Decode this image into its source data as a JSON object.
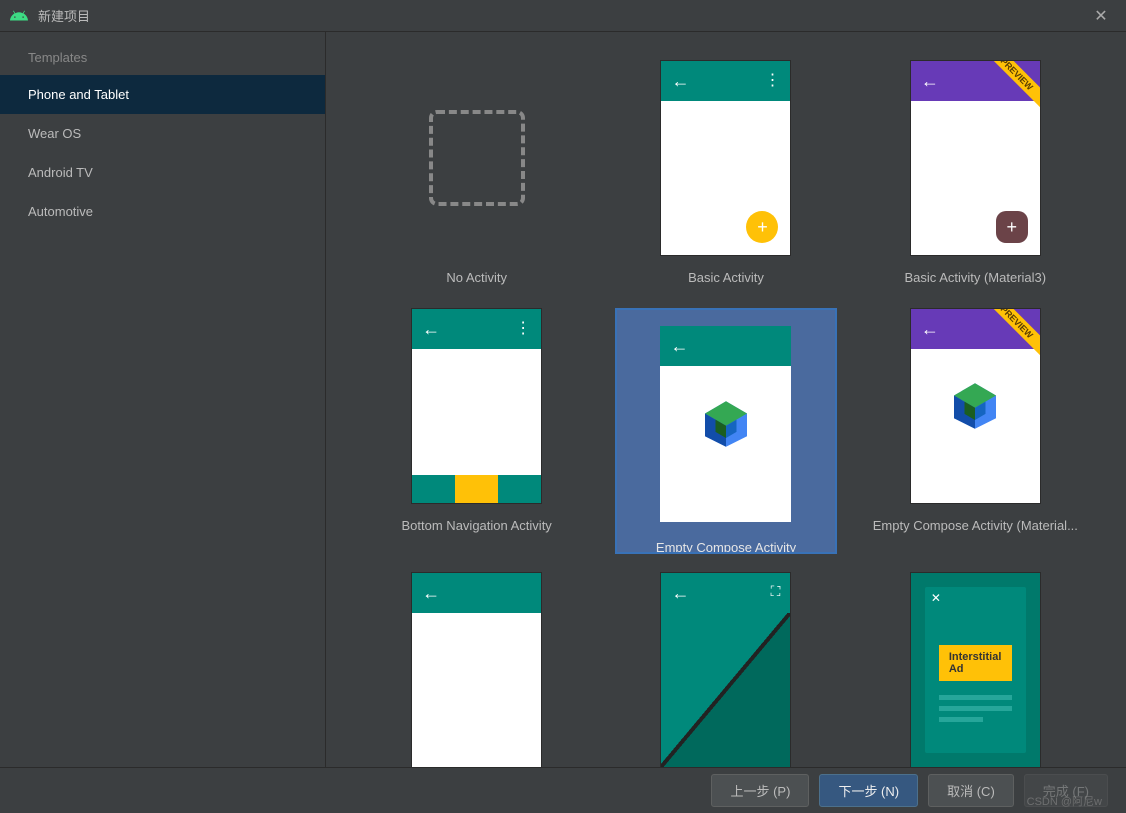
{
  "window": {
    "title": "新建项目"
  },
  "sidebar": {
    "header": "Templates",
    "items": [
      {
        "label": "Phone and Tablet",
        "active": true
      },
      {
        "label": "Wear OS",
        "active": false
      },
      {
        "label": "Android TV",
        "active": false
      },
      {
        "label": "Automotive",
        "active": false
      }
    ]
  },
  "templates": [
    {
      "label": "No Activity",
      "kind": "none"
    },
    {
      "label": "Basic Activity",
      "kind": "basic_teal"
    },
    {
      "label": "Basic Activity (Material3)",
      "kind": "basic_purple_preview"
    },
    {
      "label": "Bottom Navigation Activity",
      "kind": "bottomnav"
    },
    {
      "label": "Empty Compose Activity",
      "kind": "compose_teal",
      "selected": true
    },
    {
      "label": "Empty Compose Activity (Material...",
      "kind": "compose_purple_preview"
    },
    {
      "label": "",
      "kind": "empty_teal"
    },
    {
      "label": "",
      "kind": "fullscreen"
    },
    {
      "label": "",
      "kind": "ad"
    }
  ],
  "ad_label": "Interstitial Ad",
  "preview_label": "PREVIEW",
  "footer": {
    "prev": "上一步 (P)",
    "next": "下一步 (N)",
    "cancel": "取消 (C)",
    "finish": "完成 (F)"
  },
  "watermark": "CSDN @阿尼w"
}
